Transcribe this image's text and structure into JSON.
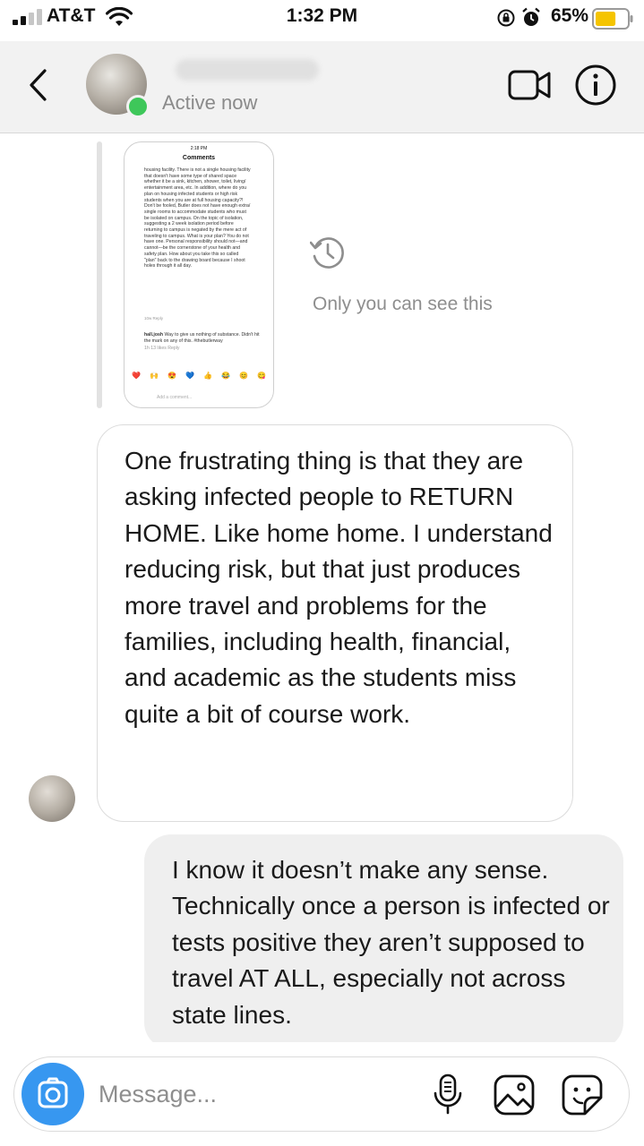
{
  "status_bar": {
    "carrier": "AT&T",
    "time": "1:32 PM",
    "battery_pct": "65%",
    "battery_level": 0.65,
    "battery_color": "#f5c400",
    "icons": [
      "signal-icon",
      "wifi-icon",
      "rotation-lock-icon",
      "alarm-icon",
      "battery-icon"
    ]
  },
  "header": {
    "status": "Active now",
    "online_color": "#3ec75a",
    "icons": [
      "back-chevron-icon",
      "video-call-icon",
      "info-icon"
    ]
  },
  "shared_screenshot": {
    "time": "2:18 PM",
    "title": "Comments",
    "body": "housing facility. There is not a single housing facility that doesn't have some type of shared space whether it be a sink, kitchen, shower, toilet, living/ entertainment area, etc. In addition, where do you plan on housing infected students or high risk students when you are at full housing capacity?! Don't be fooled, Butler does not have enough extra/ single rooms to accommodate students who must be isolated on campus. On the topic of isolation, suggesting a 2 week isolation period before returning to campus is negated by the mere act of traveling to campus. What is your plan? You do not have one. Personal responsibility should not—and cannot—be the cornerstone of your health and safety plan. How about you take this so called \"plan\" back to the drawing board because I shoot holes through it all day.",
    "meta": "10w   Reply",
    "reply_user": "hall.josh",
    "reply_text": "Way to give us nothing of substance. Didn't hit the mark on any of this. #thebutlerway",
    "reply_meta": "1h   13 likes   Reply",
    "emojis": [
      "❤️",
      "🙌",
      "😍",
      "💙",
      "👍",
      "😂",
      "😊",
      "😋"
    ],
    "add_comment": "Add a comment..."
  },
  "only_you": "Only you can see this",
  "messages": [
    {
      "direction": "incoming",
      "text": "One frustrating thing is that they are asking infected people to RETURN HOME. Like home home. I understand reducing risk, but that just produces more travel and problems for the families, including health, financial, and academic as the students miss quite a bit of course work."
    },
    {
      "direction": "outgoing",
      "text": "I know it doesn’t make any sense. Technically once a person is infected or tests positive they aren’t supposed to travel AT ALL, especially not across state lines."
    }
  ],
  "composer": {
    "placeholder": "Message...",
    "accent": "#3797f0",
    "icons": [
      "camera-icon",
      "microphone-icon",
      "gallery-icon",
      "sticker-icon"
    ]
  }
}
